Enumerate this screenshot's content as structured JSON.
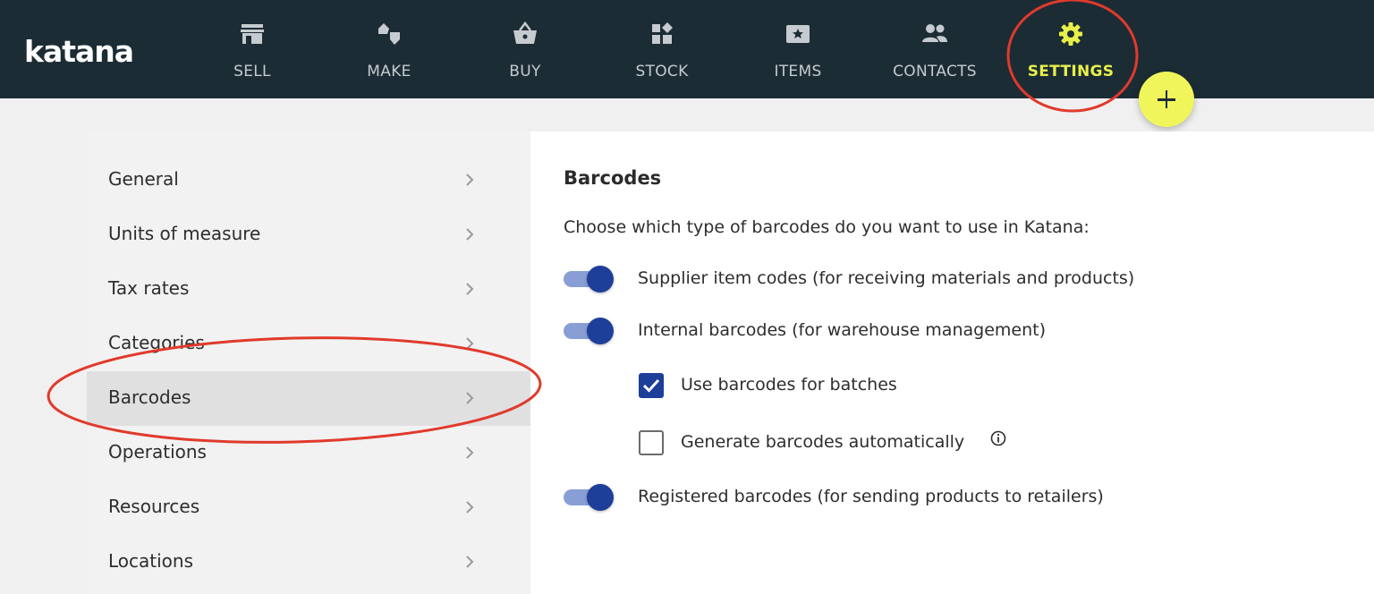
{
  "app": {
    "logo_text": "katana"
  },
  "nav": {
    "items": [
      {
        "label": "SELL",
        "icon": "store-icon"
      },
      {
        "label": "MAKE",
        "icon": "make-icon"
      },
      {
        "label": "BUY",
        "icon": "basket-icon"
      },
      {
        "label": "STOCK",
        "icon": "stock-icon"
      },
      {
        "label": "ITEMS",
        "icon": "items-icon"
      },
      {
        "label": "CONTACTS",
        "icon": "people-icon"
      },
      {
        "label": "SETTINGS",
        "icon": "gear-icon",
        "active": true
      }
    ],
    "active_color": "#e8f04a"
  },
  "sidebar": {
    "items": [
      {
        "label": "General"
      },
      {
        "label": "Units of measure"
      },
      {
        "label": "Tax rates"
      },
      {
        "label": "Categories"
      },
      {
        "label": "Barcodes",
        "selected": true
      },
      {
        "label": "Operations"
      },
      {
        "label": "Resources"
      },
      {
        "label": "Locations"
      }
    ]
  },
  "panel": {
    "title": "Barcodes",
    "description": "Choose which type of barcodes do you want to use in Katana:",
    "options": {
      "supplier": {
        "label": "Supplier item codes (for receiving materials and products)",
        "enabled": true
      },
      "internal": {
        "label": "Internal barcodes (for warehouse management)",
        "enabled": true
      },
      "batches": {
        "label": "Use barcodes for batches",
        "checked": true
      },
      "generate": {
        "label": "Generate barcodes automatically",
        "checked": false
      },
      "registered": {
        "label": "Registered barcodes (for sending products to retailers)",
        "enabled": true
      }
    }
  },
  "colors": {
    "topbar": "#1c2c35",
    "accent_blue": "#1d3f99",
    "fab_yellow": "#f0f55c",
    "annotation_red": "#e03a2c"
  }
}
